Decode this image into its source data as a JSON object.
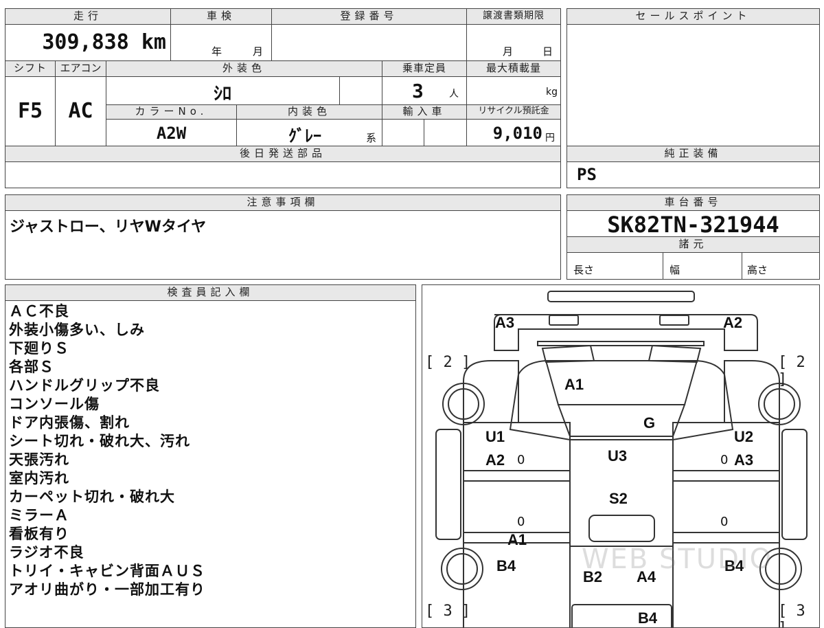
{
  "header": {
    "mileage_label": "走行",
    "shaken_label": "車検",
    "registration_label": "登録番号",
    "transfer_deadline_label": "譲渡書類期限",
    "sales_point_label": "セールスポイント"
  },
  "values": {
    "mileage": "309,838 km",
    "shaken_year_unit": "年",
    "shaken_month_unit": "月",
    "deadline_month_unit": "月",
    "deadline_day_unit": "日"
  },
  "row2": {
    "shift_label": "シフト",
    "aircon_label": "エアコン",
    "exterior_color_label": "外装色",
    "capacity_label": "乗車定員",
    "max_load_label": "最大積載量",
    "shift": "F5",
    "aircon": "AC",
    "exterior_color": "ｼﾛ",
    "capacity": "3",
    "capacity_unit": "人",
    "load_unit": "kg",
    "color_no_label": "カラーNo.",
    "interior_color_label": "内装色",
    "import_label": "輸入車",
    "recycle_label": "リサイクル預託金",
    "color_no": "A2W",
    "interior_color": "ｸﾞﾚｰ",
    "interior_suffix": "系",
    "recycle_fee": "9,010",
    "recycle_unit": "円"
  },
  "later_parts": {
    "label": "後日発送部品"
  },
  "genuine_equipment": {
    "label": "純正装備",
    "value": "PS"
  },
  "notes": {
    "label": "注意事項欄",
    "value": "ジャストロー、リヤWタイヤ"
  },
  "chassis": {
    "label": "車台番号",
    "value": "SK82TN-321944",
    "specs_label": "諸元",
    "length_label": "長さ",
    "width_label": "幅",
    "height_label": "高さ"
  },
  "inspector": {
    "label": "検査員記入欄",
    "lines": [
      "ＡＣ不良",
      "外装小傷多い、しみ",
      "下廻りＳ",
      "各部Ｓ",
      "ハンドルグリップ不良",
      "コンソール傷",
      "ドア内張傷、割れ",
      "シート切れ・破れ大、汚れ",
      "天張汚れ",
      "室内汚れ",
      "カーペット切れ・破れ大",
      "ミラーＡ",
      "看板有り",
      "ラジオ不良",
      "トリイ・キャビン背面ＡＵＳ",
      "アオリ曲がり・一部加工有り"
    ]
  },
  "diagram": {
    "marks": {
      "a3_tl": "A3",
      "a2_tr": "A2",
      "a1_top": "A1",
      "g": "G",
      "u1": "U1",
      "a2_left": "A2",
      "u3": "U3",
      "u2": "U2",
      "a3_right": "A3",
      "s2": "S2",
      "a1_mid": "A1",
      "b4_left": "B4",
      "b2": "B2",
      "a4": "A4",
      "b4_right": "B4",
      "b4_bottom": "B4"
    },
    "brackets": {
      "front_left": "[ 2 ]",
      "front_right": "[ 2 ]",
      "rear_left": "[ 3 ]",
      "rear_right": "[ 3 ]"
    },
    "zeros": [
      "0",
      "0",
      "0",
      "0"
    ],
    "watermark": "WEB STUDIO"
  }
}
